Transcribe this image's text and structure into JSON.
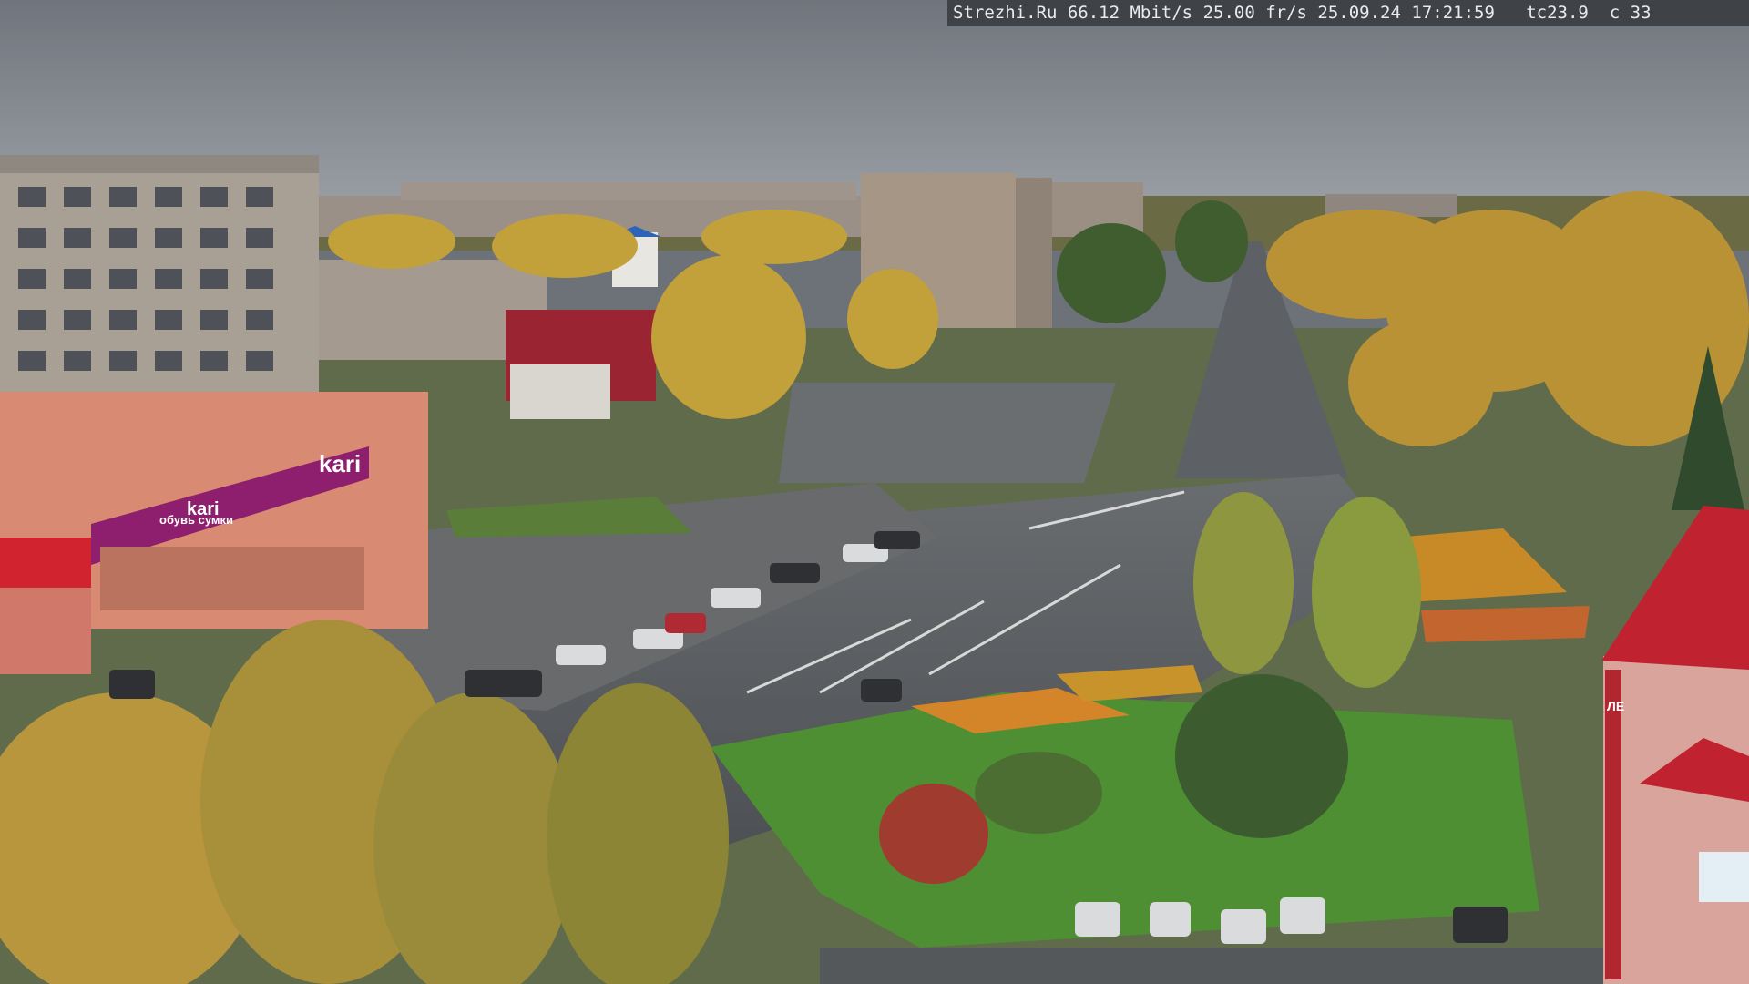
{
  "overlay": {
    "site": "Strezhi.Ru",
    "bitrate": "66.12 Mbit/s",
    "framerate": "25.00 fr/s",
    "date": "25.09.24",
    "time": "17:21:59",
    "temp": "tc23.9",
    "extra": "c 33"
  },
  "signs": {
    "store_logo": "kari",
    "store_banner": "обувь сумки",
    "store_banner2": "kari",
    "tower_sign": "ЛЕ"
  },
  "colors": {
    "sky": "#7d848c",
    "road": "#5b5e62",
    "grass": "#4f7a35",
    "foliage_yellow": "#c9a23a",
    "store_purple": "#8e1f6e",
    "roof_red": "#b4222e"
  }
}
